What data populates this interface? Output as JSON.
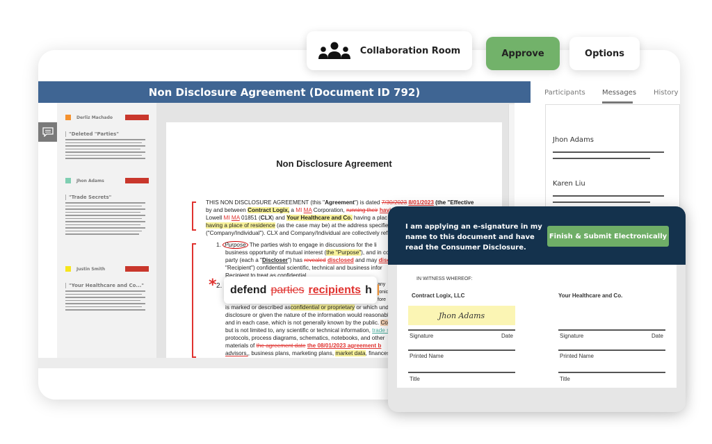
{
  "toolbar": {
    "collab_label": "Collaboration Room",
    "approve_label": "Approve",
    "options_label": "Options"
  },
  "document": {
    "title": "Non Disclosure Agreement (Document ID 792)",
    "heading": "Non Disclosure Agreement",
    "p1": {
      "a": "THIS NON DISCLOSURE AGREEMENT (this \"",
      "agreement": "Agreement",
      "b": "\") is dated ",
      "old_date": "7/30/2023",
      "new_date": "8/01/2023",
      "c": " (the \"Effective",
      "d": "by and between ",
      "party1": "Contract Logix,",
      "e": " a ",
      "mi": "MI",
      "ma": "MA",
      "f": " Corporation, ",
      "del1": "running their",
      "ins1": "having",
      "g": "Lowell ",
      "h": " 01851 (",
      "clx": "CLX",
      "i": ")  and ",
      "party2": "Your Healthcare and Co.",
      "j": " having a plac",
      "k": "having a place of residence",
      "l": " (as the case may be) at the address specified i",
      "m": "(\"Company/Individual\"). CLX and Company/Individual are collectively refe"
    },
    "s1": {
      "num": "1.",
      "purpose": "Purpose",
      "a": " The parties wish to engage in discussions for the li",
      "b": "business opportunity of mutual interest (",
      "purpose_q": "the \"Purpose\"",
      "c": "), and in con",
      "d": "party (each a \"",
      "discloser": "Discloser",
      "e": "\") has ",
      "del": "revealed",
      "ins": "disclosed",
      "f": " and may ",
      "g": "disclo",
      "h": "\"Recipient\") confidential scientific, technical and business infor",
      "i": "Recipient to treat as confidential."
    },
    "s2": {
      "num": "2.",
      "lines": [
        "is marked or described as",
        "confidential or proprietary",
        "or which under",
        "disclosure or given the nature of the information would reasonably",
        "and in each case, which is not generally known by the public. ",
        "Co",
        "but is not limited to, any scientific or technical information, ",
        "trade se",
        "protocols, process diagrams, schematics, notebooks, and other",
        "materials of ",
        "the agreement date",
        "the 08/01/2023 agreement b",
        "advisors,",
        ", business plans, marketing plans, ",
        "market data",
        ", finances a"
      ],
      "right": [
        "any",
        "ronic",
        "fore"
      ]
    },
    "edit_popup": {
      "word": "defend",
      "deleted": "parties",
      "inserted": "recipients",
      "typing": "h"
    }
  },
  "comments": [
    {
      "author": "Derliz Machado",
      "color": "#f5922f",
      "quote": "\"Deleted \"Parties\""
    },
    {
      "author": "Jhon Adams",
      "color": "#7fcfb2",
      "quote": "\"Trade Secrets\""
    },
    {
      "author": "Justin Smith",
      "color": "#f7e51c",
      "quote": "\"Your Healthcare and Co...\""
    }
  ],
  "right_panel": {
    "tabs": [
      "Participants",
      "Messages",
      "History"
    ],
    "active_tab": "Messages",
    "participants": [
      "Jhon Adams",
      "Karen Liu"
    ]
  },
  "esign": {
    "statement": "I am applying an e-signature in my name to this document and have read the Consumer Disclosure.",
    "submit_label": "Finish & Submit Electronically",
    "witness": "IN WITNESS WHEREOF:",
    "party1": "Contract Logix, LLC",
    "party2": "Your Healthcare and Co.",
    "signature_value": "Jhon Adams",
    "signature_label": "Signature",
    "date_label": "Date",
    "printed_name_label": "Printed Name",
    "title_label": "Title"
  },
  "colors": {
    "title_bar": "#3f6593",
    "approve": "#72b26a",
    "esign_header": "#14324d",
    "badge": "#c9372c",
    "redline": "#e0322f"
  }
}
